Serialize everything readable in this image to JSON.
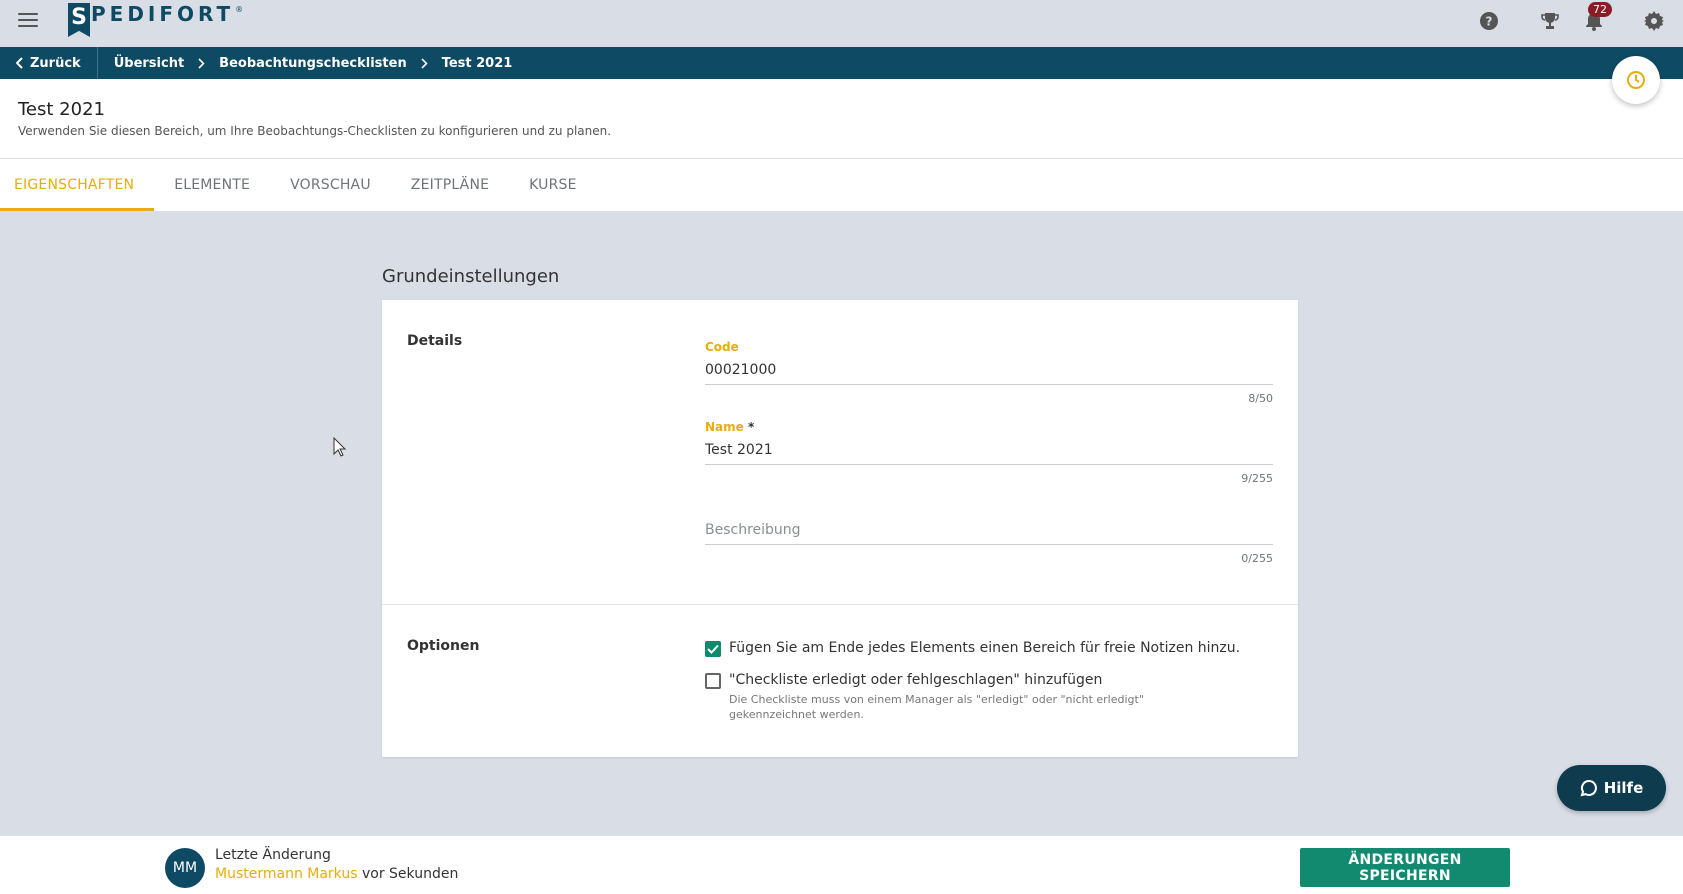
{
  "app": {
    "logo_letter": "S",
    "logo_text": "PEDIFORT",
    "logo_reg": "®",
    "notifications_count": "72",
    "icons": [
      "menu-icon",
      "help-circle-icon",
      "trophy-icon",
      "bell-icon",
      "gear-icon"
    ]
  },
  "breadcrumb": {
    "back_label": "Zurück",
    "items": [
      "Übersicht",
      "Beobachtungschecklisten",
      "Test 2021"
    ]
  },
  "header": {
    "title": "Test 2021",
    "subtitle": "Verwenden Sie diesen Bereich, um Ihre Beobachtungs-Checklisten zu konfigurieren und zu planen."
  },
  "tabs": [
    {
      "label": "EIGENSCHAFTEN",
      "active": true
    },
    {
      "label": "ELEMENTE",
      "active": false
    },
    {
      "label": "VORSCHAU",
      "active": false
    },
    {
      "label": "ZEITPLÄNE",
      "active": false
    },
    {
      "label": "KURSE",
      "active": false
    }
  ],
  "section": {
    "title": "Grundeinstellungen",
    "details_label": "Details",
    "options_label": "Optionen"
  },
  "fields": {
    "code": {
      "label": "Code",
      "value": "00021000",
      "count": "8/50"
    },
    "name": {
      "label": "Name",
      "required_mark": "*",
      "value": "Test 2021",
      "count": "9/255"
    },
    "description": {
      "placeholder": "Beschreibung",
      "value": "",
      "count": "0/255"
    }
  },
  "options": {
    "notes": {
      "label": "Fügen Sie am Ende jedes Elements einen Bereich für freie Notizen hinzu.",
      "checked": true
    },
    "done_failed": {
      "label": "\"Checkliste erledigt oder fehlgeschlagen\" hinzufügen",
      "hint": "Die Checkliste muss von einem Manager als \"erledigt\" oder \"nicht erledigt\" gekennzeichnet werden.",
      "checked": false
    }
  },
  "help": {
    "label": "Hilfe"
  },
  "footer": {
    "avatar_initials": "MM",
    "last_change_label": "Letzte Änderung",
    "user": "Mustermann Markus",
    "time": "vor Sekunden",
    "save_label": "ÄNDERUNGEN SPEICHERN"
  },
  "colors": {
    "brand": "#0e4a63",
    "accent": "#e8ac0c",
    "success": "#128a70",
    "background": "#d9dde6"
  }
}
